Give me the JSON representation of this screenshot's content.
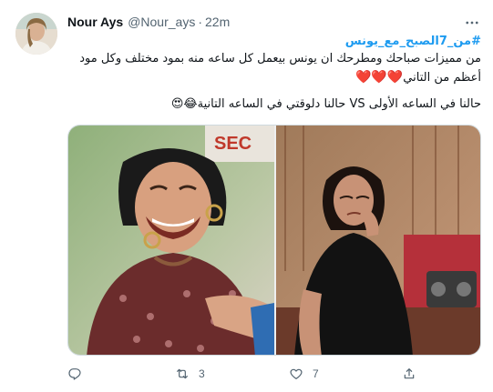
{
  "author": {
    "name": "Nour Ays",
    "handle": "@Nour_ays",
    "separator": "·",
    "time": "22m"
  },
  "tweet": {
    "hashtag": "#من_7الصبح_مع_يونس",
    "line1": "من مميزات صباحك ومطرحك ان يونس بيعمل كل ساعه منه بمود مختلف وكل مود",
    "line2_text": "أعظم من التاني",
    "line2_hearts": "❤️❤️❤️",
    "line3_text": "حالنا في الساعه الأولى VS حالنا دلوقتي في الساعه التانية",
    "line3_emojis": "😂😍"
  },
  "media": {
    "left_photo": "woman-laughing-photo",
    "right_photo": "woman-crying-photo",
    "watermark": "SEC"
  },
  "actions": {
    "reply_count": "",
    "retweet_count": "3",
    "like_count": "7"
  },
  "colors": {
    "accent": "#1d9bf0",
    "text": "#0f1419",
    "muted": "#536471",
    "heart": "#e0245e"
  },
  "icons": [
    "more-icon",
    "reply-icon",
    "retweet-icon",
    "like-icon",
    "share-icon"
  ]
}
